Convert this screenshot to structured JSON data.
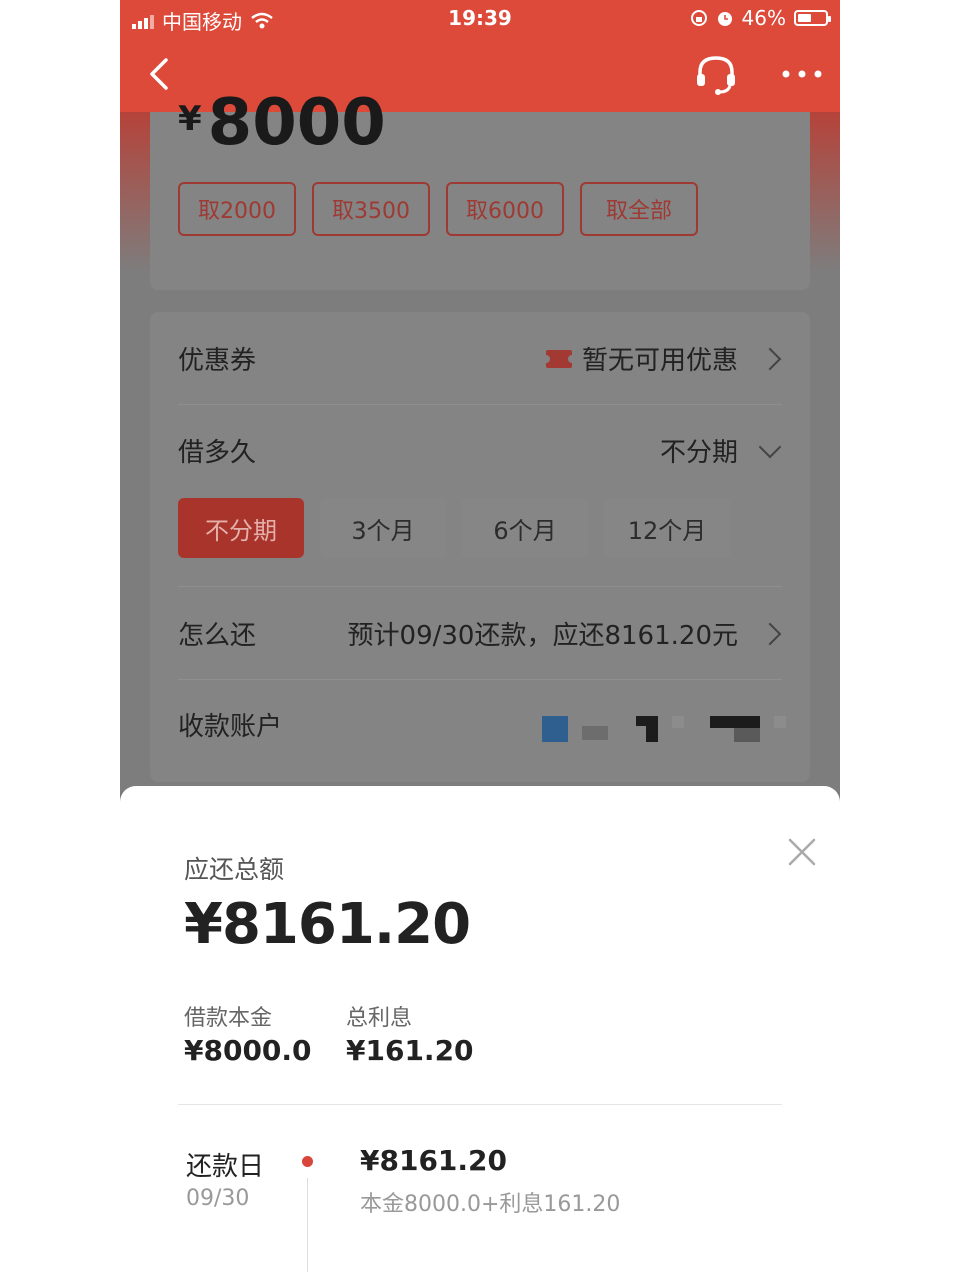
{
  "status_bar": {
    "carrier": "中国移动",
    "time": "19:39",
    "battery": "46%"
  },
  "top_card": {
    "currency": "¥",
    "amount": "8000",
    "quick_amounts": [
      "取2000",
      "取3500",
      "取6000",
      "取全部"
    ]
  },
  "coupon_row": {
    "label": "优惠券",
    "value": "暂无可用优惠"
  },
  "term_row": {
    "label": "借多久",
    "value": "不分期",
    "options": [
      "不分期",
      "3个月",
      "6个月",
      "12个月"
    ],
    "selected_index": 0
  },
  "repay_row": {
    "label": "怎么还",
    "value": "预计09/30还款，应还8161.20元"
  },
  "account_row": {
    "label": "收款账户"
  },
  "sheet": {
    "title": "应还总额",
    "total": "¥8161.20",
    "principal_label": "借款本金",
    "principal": "¥8000.0",
    "interest_label": "总利息",
    "interest": "¥161.20",
    "repay_day_label": "还款日",
    "repay_date": "09/30",
    "repay_amount": "¥8161.20",
    "repay_detail": "本金8000.0+利息161.20"
  },
  "colors": {
    "brand": "#dd4a3a",
    "accent_dark": "#a8342c",
    "dot": "#d9453a"
  },
  "icons": [
    "back-icon",
    "headset-icon",
    "more-icon",
    "coupon-icon",
    "chevron-right-icon",
    "chevron-down-icon",
    "close-icon"
  ]
}
